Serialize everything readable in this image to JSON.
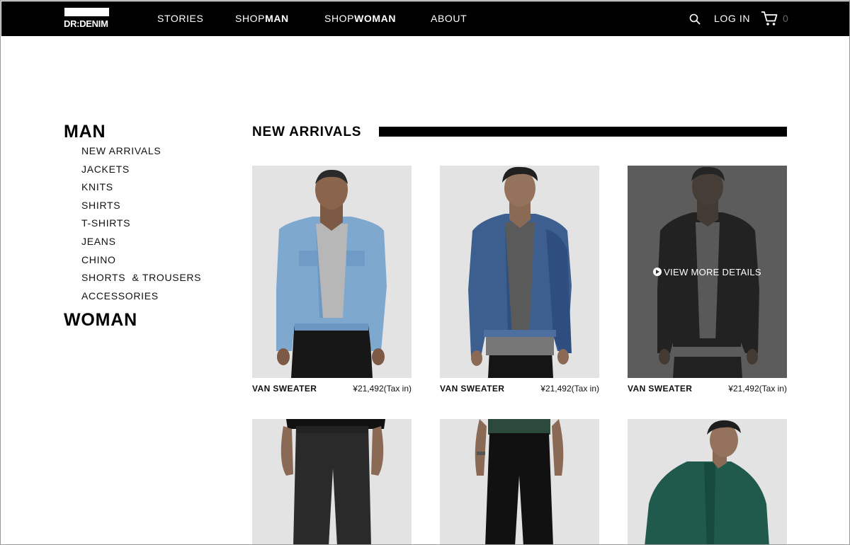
{
  "brand": {
    "logo_text": "DR:DENIM"
  },
  "nav": {
    "stories": "STORIES",
    "shop_man_prefix": "SHOP",
    "shop_man_bold": "MAN",
    "shop_woman_prefix": "SHOP",
    "shop_woman_bold": "WOMAN",
    "about": "ABOUT",
    "login": "LOG IN",
    "cart_count": "0"
  },
  "sidebar": {
    "man_heading": "MAN",
    "items": [
      {
        "label": "NEW ARRIVALS"
      },
      {
        "label": "JACKETS"
      },
      {
        "label": "KNITS"
      },
      {
        "label": "SHIRTS"
      },
      {
        "label": "T-SHIRTS"
      },
      {
        "label": "JEANS"
      },
      {
        "label": "CHINO"
      },
      {
        "label": "SHORTS  & TROUSERS"
      },
      {
        "label": "ACCESSORIES"
      }
    ],
    "woman_heading": "WOMAN"
  },
  "section": {
    "title": "NEW ARRIVALS"
  },
  "products": [
    {
      "name": "VAN SWEATER",
      "price": "¥21,492(Tax in)"
    },
    {
      "name": "VAN SWEATER",
      "price": "¥21,492(Tax in)"
    },
    {
      "name": "VAN SWEATER",
      "price": "¥21,492(Tax in)",
      "hover_text": "VIEW MORE DETAILS"
    }
  ],
  "colors": {
    "nav_bg": "#000000",
    "accent": "#000000",
    "photo_bg": "#e4e4e5"
  }
}
